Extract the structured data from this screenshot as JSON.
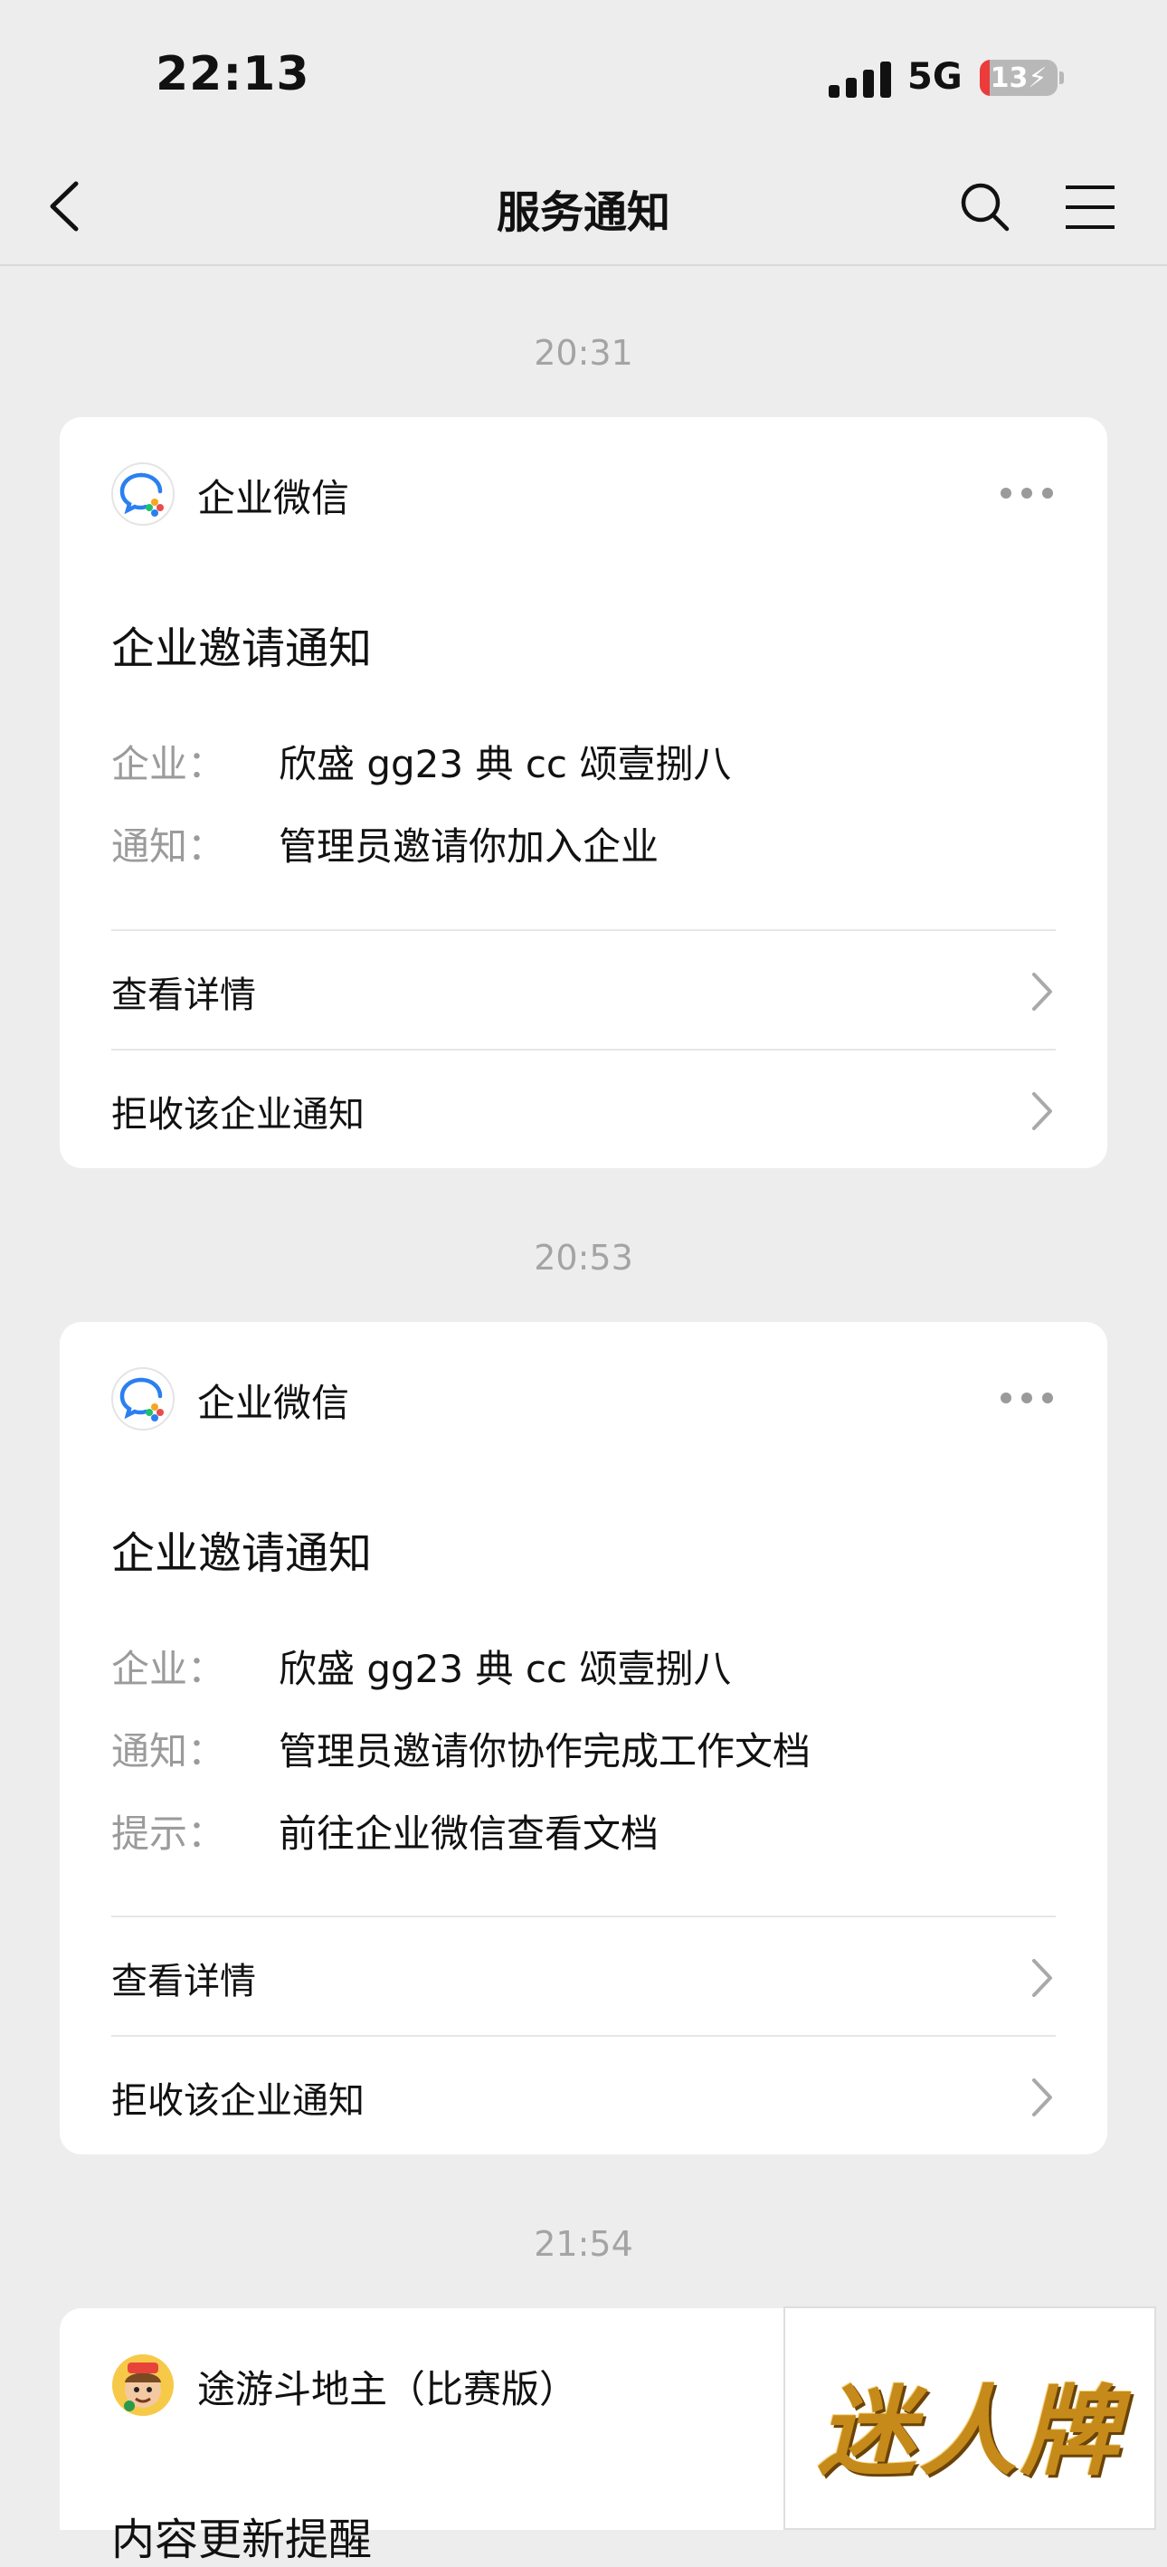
{
  "status_bar": {
    "time": "22:13",
    "network": "5G",
    "battery": "13",
    "battery_level_percent": 13,
    "signal_icon": "signal-bars-icon",
    "battery_icon": "battery-charging-icon"
  },
  "nav": {
    "title": "服务通知",
    "back_icon": "chevron-left-icon",
    "search_icon": "search-icon",
    "menu_icon": "menu-icon"
  },
  "messages": [
    {
      "time": "20:31",
      "sender": "企业微信",
      "title": "企业邀请通知",
      "fields": [
        {
          "label": "企业：",
          "value": "欣盛 gg23 典 cc 颂壹捌八"
        },
        {
          "label": "通知：",
          "value": "管理员邀请你加入企业"
        }
      ],
      "actions": [
        "查看详情",
        "拒收该企业通知"
      ]
    },
    {
      "time": "20:53",
      "sender": "企业微信",
      "title": "企业邀请通知",
      "fields": [
        {
          "label": "企业：",
          "value": "欣盛 gg23 典 cc 颂壹捌八"
        },
        {
          "label": "通知：",
          "value": "管理员邀请你协作完成工作文档"
        },
        {
          "label": "提示：",
          "value": "前往企业微信查看文档"
        }
      ],
      "actions": [
        "查看详情",
        "拒收该企业通知"
      ]
    },
    {
      "time": "21:54",
      "sender": "途游斗地主（比赛版）",
      "title": "内容更新提醒"
    }
  ],
  "overlay_ad": {
    "text": "迷人牌"
  },
  "colors": {
    "background": "#ededed",
    "card": "#ffffff",
    "muted_text": "#9b9b9b",
    "battery_low": "#ec3b3b",
    "wecom_blue": "#2b7ff0"
  }
}
